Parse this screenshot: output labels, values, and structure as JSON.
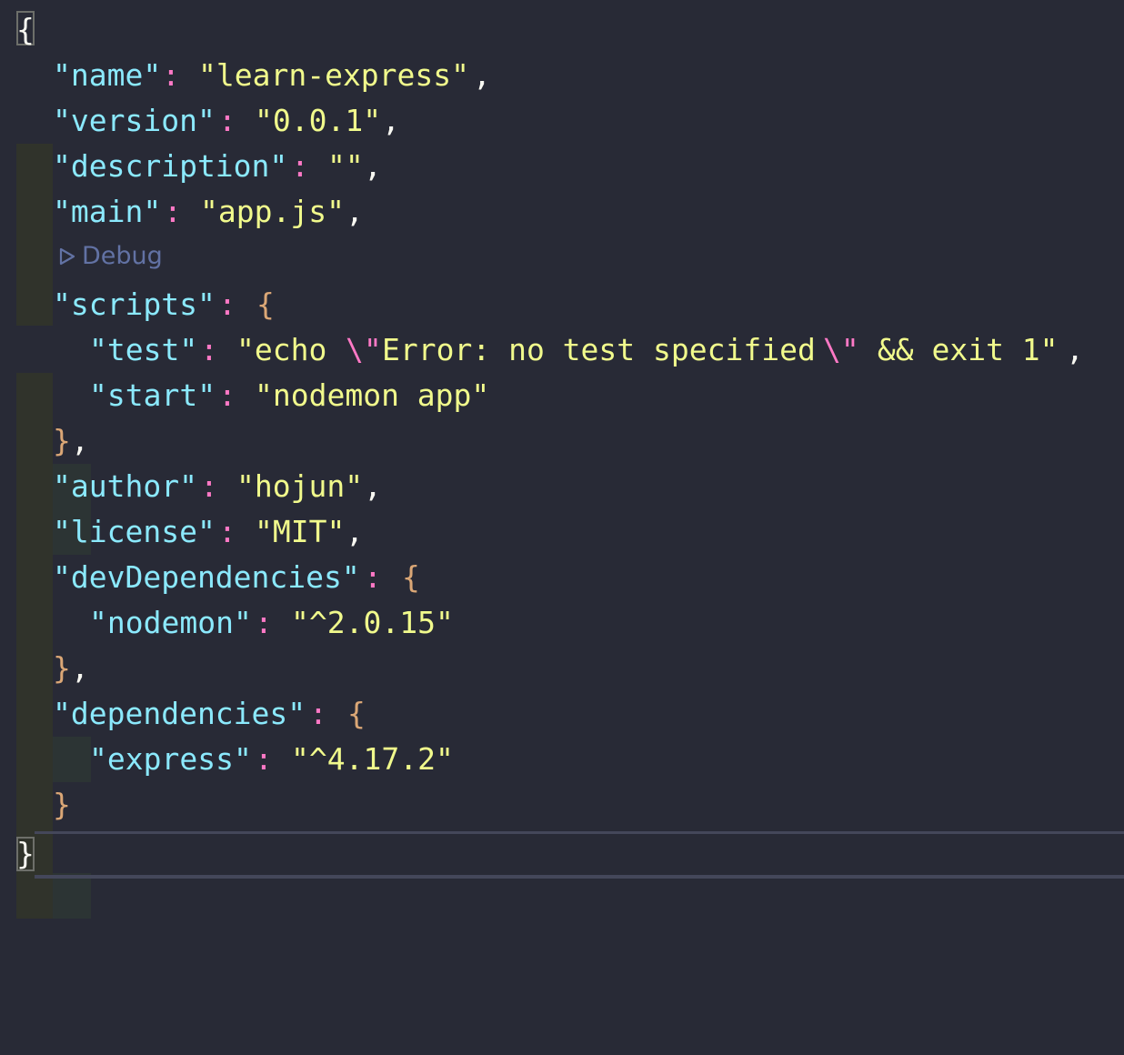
{
  "editor": {
    "file": {
      "open_brace": "{",
      "close_brace": "}",
      "name_key": "\"name\"",
      "name_value": "\"learn-express\"",
      "version_key": "\"version\"",
      "version_value": "\"0.0.1\"",
      "description_key": "\"description\"",
      "description_value": "\"\"",
      "main_key": "\"main\"",
      "main_value": "\"app.js\"",
      "scripts_key": "\"scripts\"",
      "test_key": "\"test\"",
      "test_value_part1": "\"echo ",
      "test_value_esc1": "\\\"",
      "test_value_part2": "Error: no test specified",
      "test_value_esc2": "\\\"",
      "test_value_part3": " && exit 1\"",
      "start_key": "\"start\"",
      "start_value": "\"nodemon app\"",
      "author_key": "\"author\"",
      "author_value": "\"hojun\"",
      "license_key": "\"license\"",
      "license_value": "\"MIT\"",
      "devdeps_key": "\"devDependencies\"",
      "nodemon_key": "\"nodemon\"",
      "nodemon_value": "\"^2.0.15\"",
      "deps_key": "\"dependencies\"",
      "express_key": "\"express\"",
      "express_value": "\"^4.17.2\""
    },
    "codelens": {
      "debug_label": "Debug",
      "icon": "play-outline-icon"
    },
    "punctuation": {
      "colon": ":",
      "comma": ",",
      "obj_open": "{",
      "obj_close": "}",
      "obj_close_comma": "},"
    },
    "colors": {
      "background": "#282a36",
      "key": "#8be9fd",
      "string": "#f1fa8c",
      "operator": "#ff79c6",
      "brace": "#dba776",
      "codelens": "#6272a4"
    }
  }
}
